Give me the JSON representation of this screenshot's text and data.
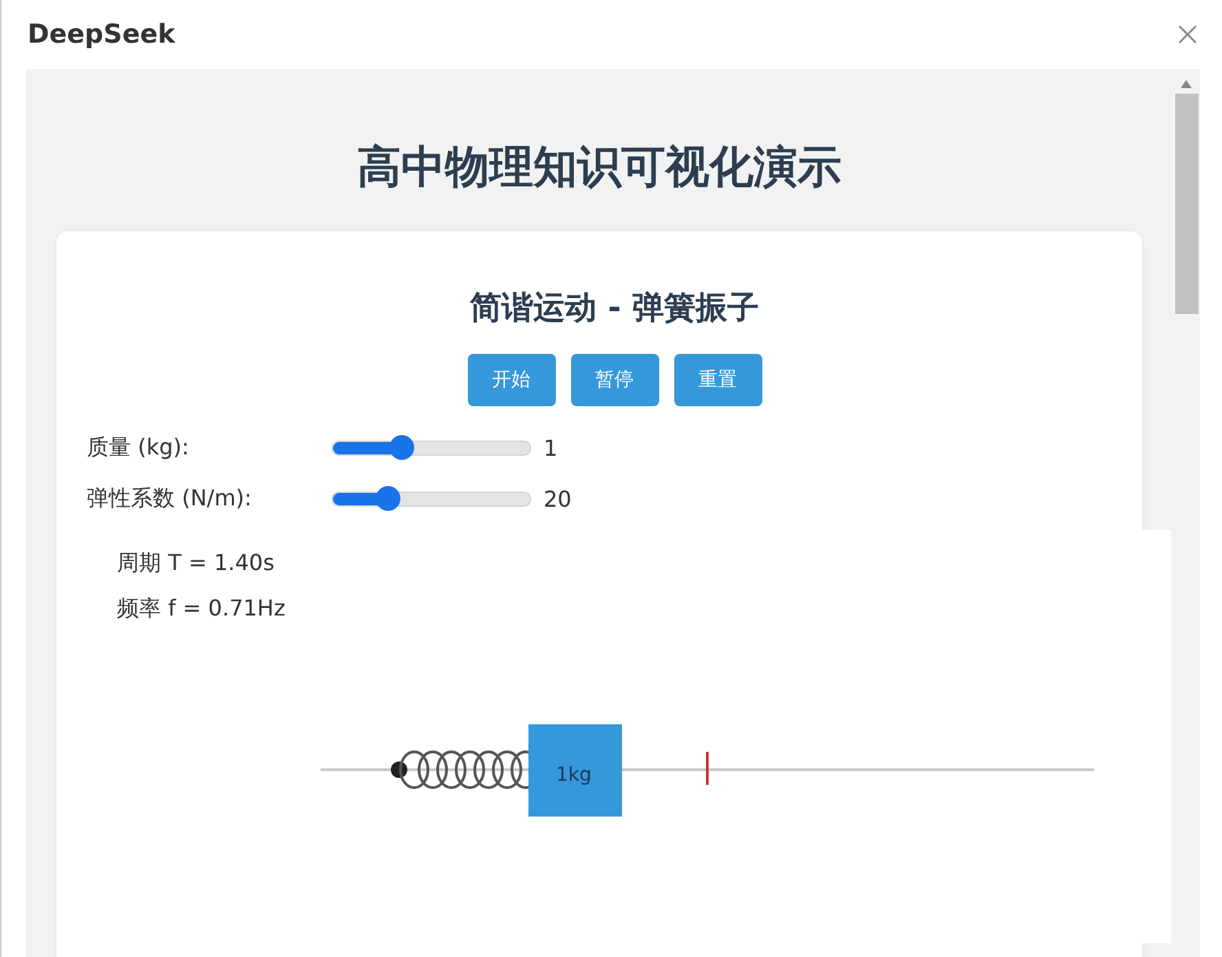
{
  "window": {
    "title": "DeepSeek"
  },
  "page_title": "高中物理知识可视化演示",
  "card": {
    "title": "简谐运动 - 弹簧振子",
    "buttons": [
      "开始",
      "暂停",
      "重置"
    ],
    "sliders": [
      {
        "label": "质量 (kg):",
        "level": 0.35,
        "reading": "1"
      },
      {
        "label": "弹性系数 (N/m):",
        "level": 0.28,
        "reading": "20"
      }
    ],
    "readouts": [
      "周期 T = 1.40s",
      "频率 f = 0.71Hz"
    ],
    "mass_label": "1kg"
  }
}
